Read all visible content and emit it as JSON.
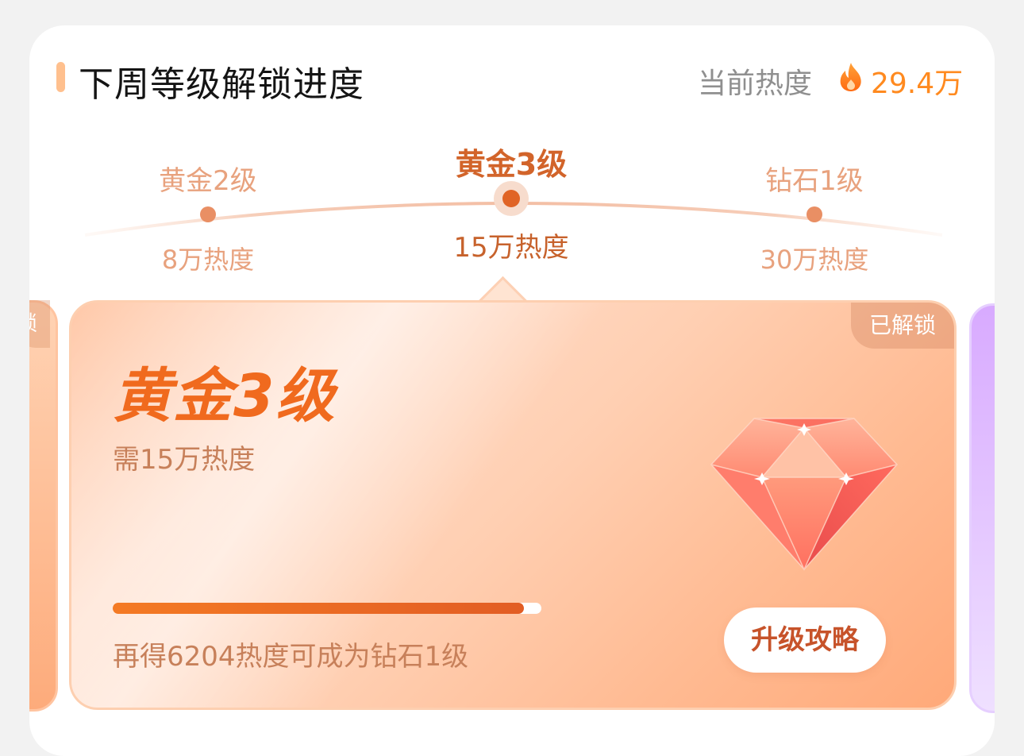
{
  "header": {
    "title": "下周等级解锁进度",
    "heat_label": "当前热度",
    "heat_icon": "fire-icon",
    "heat_value": "29.4万"
  },
  "levels": [
    {
      "name": "黄金2级",
      "heat": "8万热度",
      "active": false
    },
    {
      "name": "黄金3级",
      "heat": "15万热度",
      "active": true
    },
    {
      "name": "钻石1级",
      "heat": "30万热度",
      "active": false
    }
  ],
  "card": {
    "title": "黄金3级",
    "requirement": "需15万热度",
    "badge": "已解锁",
    "progress_fraction": 0.96,
    "progress_text": "再得6204热度可成为钻石1级",
    "guide_button": "升级攻略",
    "icon": "diamond-gem-icon"
  },
  "prev_card": {
    "badge": "锁"
  },
  "colors": {
    "accent_orange": "#f06a1e",
    "heat_orange": "#ff8a1f",
    "card_peach": "#ffc8a8",
    "next_card_purple": "#d8aaff"
  }
}
